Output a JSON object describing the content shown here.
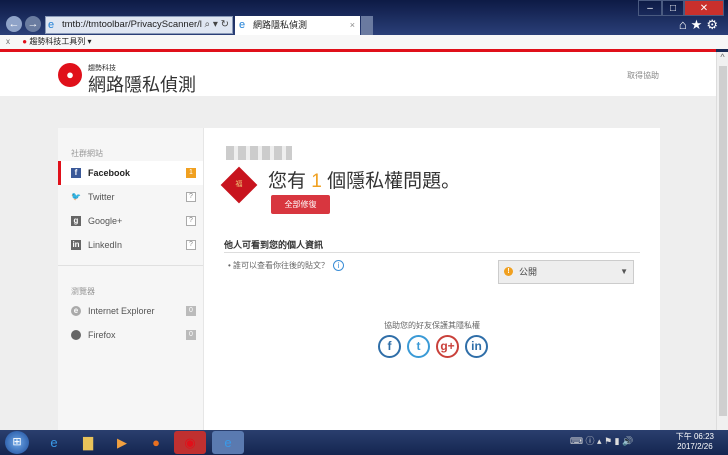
{
  "browser": {
    "url": "tmtb://tmtoolbar/PrivacyScanner/loca",
    "tab_title": "網路隱私偵測",
    "toolbar_label": "趨勢科技工具列",
    "close_toolbar": "x"
  },
  "header": {
    "brand_small": "趨勢科技",
    "brand": "網路隱私偵測",
    "help": "取得協助"
  },
  "sidebar": {
    "social_section": "社群網站",
    "social": [
      {
        "label": "Facebook",
        "badge": "1"
      },
      {
        "label": "Twitter",
        "badge": "?"
      },
      {
        "label": "Google+",
        "badge": "?"
      },
      {
        "label": "LinkedIn",
        "badge": "?"
      }
    ],
    "browser_section": "瀏覽器",
    "browsers": [
      {
        "label": "Internet Explorer",
        "badge": "0"
      },
      {
        "label": "Firefox",
        "badge": "0"
      }
    ]
  },
  "main": {
    "headline_pre": "您有",
    "count": "1",
    "headline_post": "個隱私權問題。",
    "fix_all": "全部修復",
    "section_title": "他人可看到您的個人資訊",
    "question": "誰可以查看你往後的貼文？",
    "setting_value": "公開",
    "share_text": "協助您的好友保護其隱私權",
    "seal_text": "福"
  },
  "colors": {
    "accent": "#e0101a",
    "warning": "#f0a020",
    "button": "#d8363f"
  },
  "taskbar": {
    "time": "下午 06:23",
    "date": "2017/2/26"
  }
}
